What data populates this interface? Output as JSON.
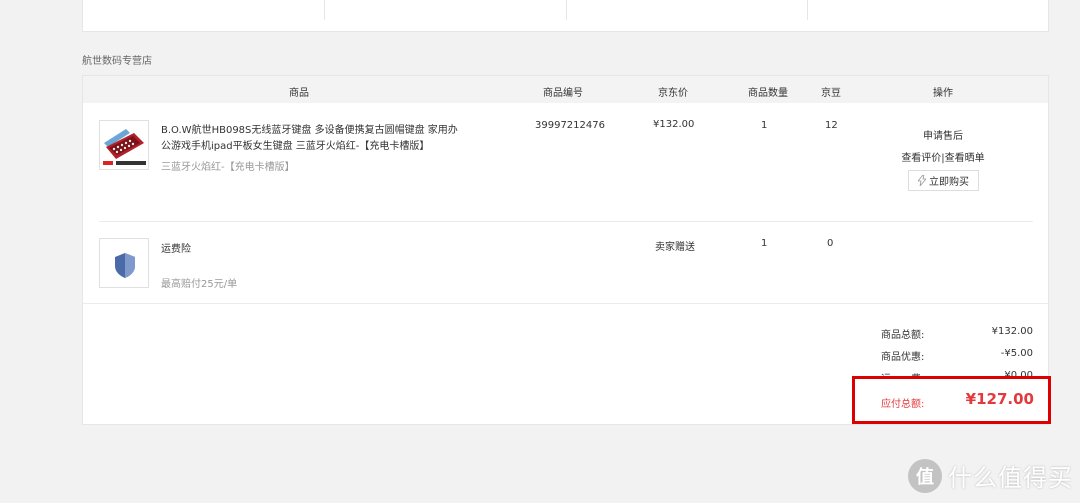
{
  "store": {
    "name": "航世数码专营店"
  },
  "table": {
    "headers": {
      "product": "商品",
      "sku": "商品编号",
      "price": "京东价",
      "qty": "商品数量",
      "beans": "京豆",
      "actions": "操作"
    }
  },
  "items": [
    {
      "title": "B.O.W航世HB098S无线蓝牙键盘 多设备便携复古圆帽键盘 家用办公游戏手机ipad平板女生键盘 三蓝牙火焰红-【充电卡槽版】",
      "spec": "三蓝牙火焰红-【充电卡槽版】",
      "sku": "39997212476",
      "price": "¥132.00",
      "qty": "1",
      "beans": "12",
      "thumb_icon": "keyboard-product-image",
      "actions": {
        "after_sale": "申请售后",
        "review": "查看评价|查看晒单",
        "buy_again": "立即购买"
      }
    },
    {
      "title": "运费险",
      "spec": "最高赔付25元/单",
      "price": "卖家赠送",
      "qty": "1",
      "beans": "0",
      "thumb_icon": "shield-icon"
    }
  ],
  "summary": {
    "goods_total_label": "商品总额:",
    "goods_total": "¥132.00",
    "discount_label": "商品优惠:",
    "discount": "-¥5.00",
    "shipping_label": "运　　费:",
    "shipping": "¥0.00",
    "payable_label": "应付总额:",
    "payable": "¥127.00"
  },
  "watermark": {
    "logo": "值",
    "text": "什么值得买"
  },
  "colors": {
    "accent": "#e4393c",
    "highlight_border": "#dd0000"
  }
}
